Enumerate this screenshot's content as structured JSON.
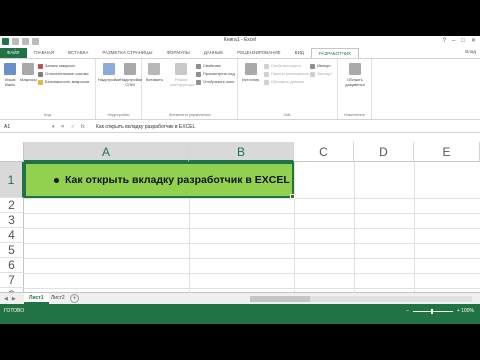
{
  "app": {
    "title": "Книга1 - Excel",
    "user": "Влад",
    "window_controls": [
      "?",
      "–",
      "□",
      "✕"
    ]
  },
  "tabs": [
    "ФАЙЛ",
    "ГЛАВНАЯ",
    "ВСТАВКА",
    "РАЗМЕТКА СТРАНИЦЫ",
    "ФОРМУЛЫ",
    "ДАННЫЕ",
    "РЕЦЕНЗИРОВАНИЕ",
    "ВИД",
    "РАЗРАБОТЧИК"
  ],
  "active_tab": "РАЗРАБОТЧИК",
  "ribbon": {
    "code": {
      "label": "Код",
      "vba": "Visual Basic",
      "macros": "Макросы",
      "record": "Запись макроса",
      "relative": "Относительные ссылки",
      "security": "Безопасность макросов"
    },
    "addins": {
      "label": "Надстройки",
      "addins": "Надстройки",
      "com": "Надстройки COM"
    },
    "controls": {
      "label": "Элементы управления",
      "insert": "Вставить",
      "design": "Режим конструктора",
      "properties": "Свойства",
      "view_code": "Просмотреть код",
      "dialog": "Отобразить окно"
    },
    "xml": {
      "label": "XML",
      "source": "Источник",
      "map_props": "Свойства карты",
      "expansion": "Пакеты расширения",
      "refresh": "Обновить данные",
      "import": "Импорт",
      "export": "Экспорт"
    },
    "modify": {
      "label": "Изменение",
      "panel": "Область документа"
    }
  },
  "formula_bar": {
    "name_box": "A1",
    "fx_icons": [
      "▾",
      "✕",
      "✓",
      "fx"
    ],
    "content": "Как открыть вкладку разработчик в EXCEL"
  },
  "grid": {
    "columns": [
      "A",
      "B",
      "C",
      "D",
      "E"
    ],
    "selected_columns": [
      "A",
      "B"
    ],
    "rows": [
      "1",
      "2",
      "3",
      "4",
      "5",
      "6",
      "7",
      "8"
    ],
    "selected_row": "1",
    "cell_text": "Как открыть вкладку разработчик в EXCEL",
    "cell_fill": "#92d050"
  },
  "sheets": {
    "tabs": [
      "Лист1",
      "Лист2"
    ],
    "active": "Лист1",
    "nav": [
      "◀",
      "▶"
    ],
    "add": "+"
  },
  "status": {
    "text": "ГОТОВО",
    "zoom_minus": "–",
    "zoom_plus": "+",
    "zoom_level": "+ 100%"
  },
  "colors": {
    "accent": "#217346",
    "cell_fill": "#92d050"
  }
}
